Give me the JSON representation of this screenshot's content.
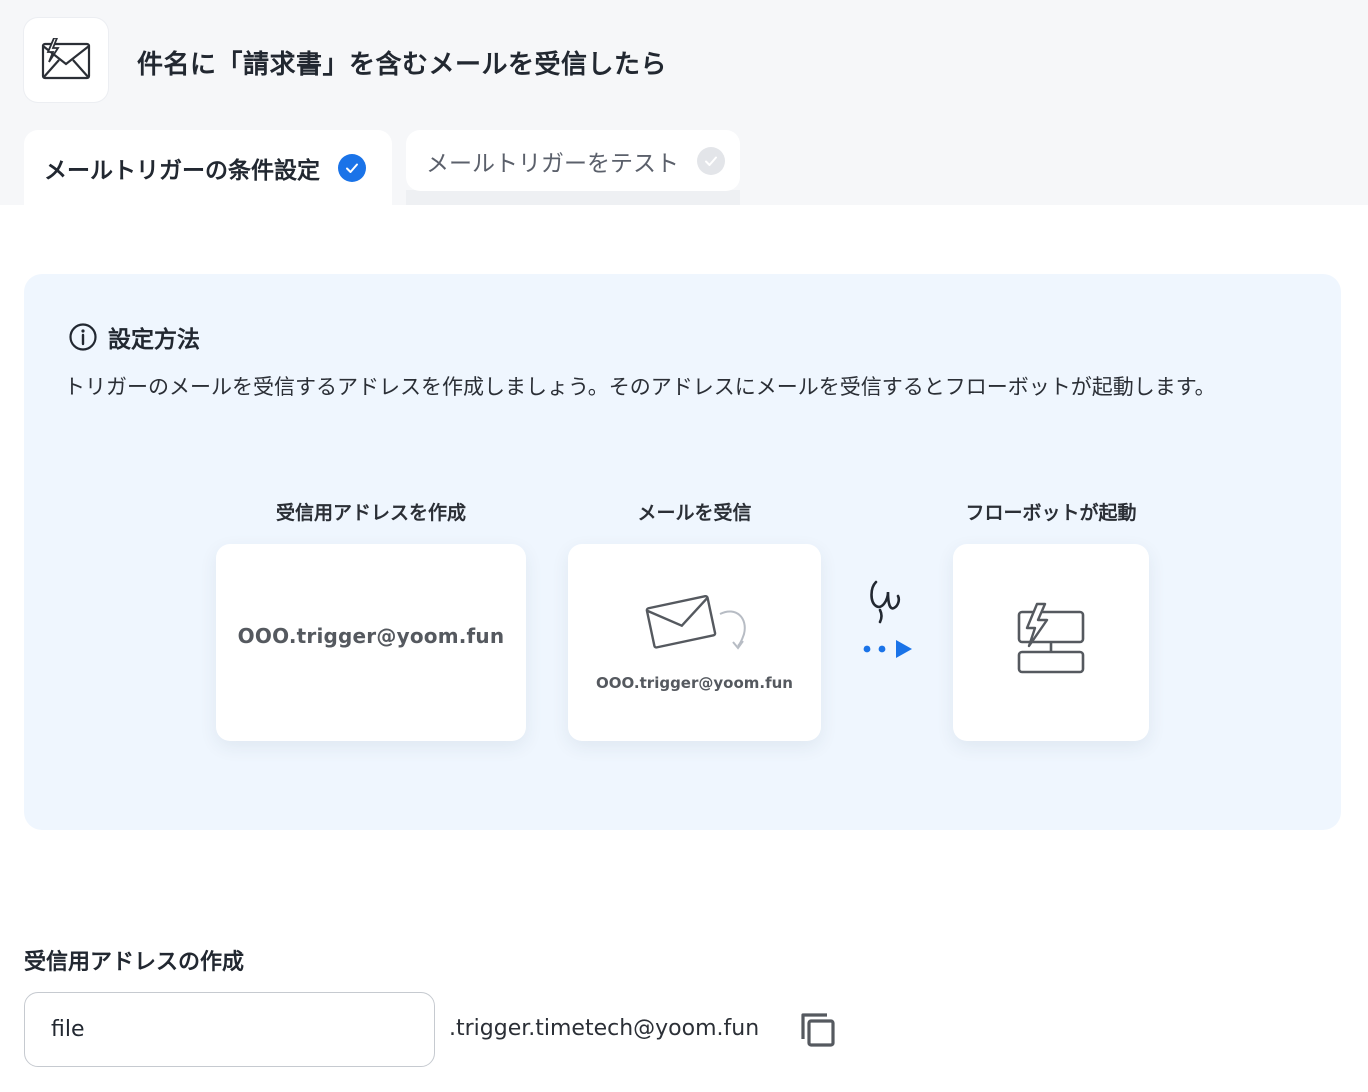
{
  "header": {
    "title": "件名に「請求書」を含むメールを受信したら",
    "icon": "mail-trigger-icon"
  },
  "tabs": [
    {
      "label": "メールトリガーの条件設定",
      "state": "completed"
    },
    {
      "label": "メールトリガーをテスト",
      "state": "pending"
    }
  ],
  "info": {
    "heading": "設定方法",
    "description": "トリガーのメールを受信するアドレスを作成しましょう。そのアドレスにメールを受信するとフローボットが起動します。"
  },
  "steps": [
    {
      "title": "受信用アドレスを作成",
      "content": "OOO.trigger@yoom.fun"
    },
    {
      "title": "メールを受信",
      "content": "OOO.trigger@yoom.fun"
    },
    {
      "title": "フローボットが起動"
    }
  ],
  "address_section": {
    "title": "受信用アドレスの作成",
    "input_value": "file",
    "suffix": ".trigger.timetech@yoom.fun"
  },
  "colors": {
    "accent": "#1a73e8",
    "panel_bg": "#eff6fe",
    "top_bg": "#f6f7f9"
  }
}
